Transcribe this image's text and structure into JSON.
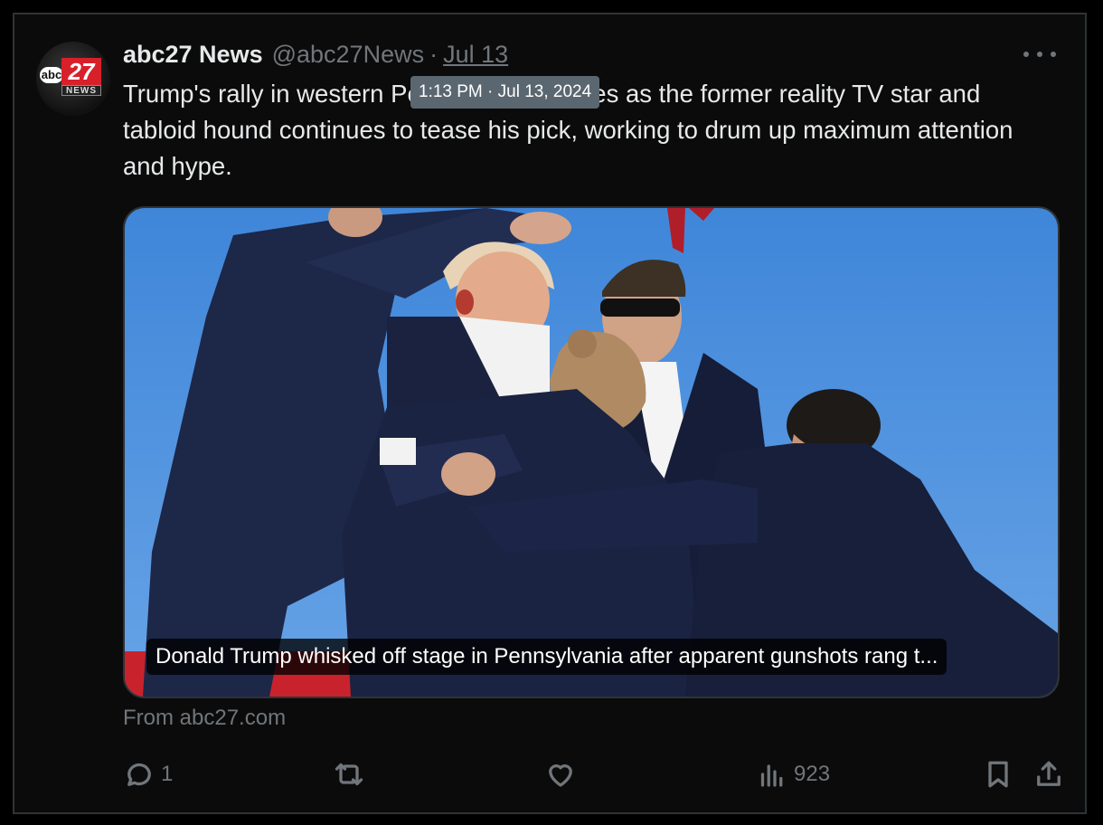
{
  "author": {
    "display_name": "abc27 News",
    "handle": "@abc27News",
    "separator": "·",
    "date": "Jul 13",
    "logo_abc": "abc",
    "logo_number": "27",
    "logo_news": "NEWS"
  },
  "tooltip": {
    "text": "1:13 PM · Jul 13, 2024"
  },
  "tweet": {
    "text": "Trump's rally in western Pennsylvania comes as the former reality TV star and tabloid hound continues to tease his pick, working to drum up maximum attention and hype."
  },
  "card": {
    "caption": "Donald Trump whisked off stage in Pennsylvania after apparent gunshots rang t...",
    "source": "From abc27.com"
  },
  "actions": {
    "reply_count": "1",
    "retweet_count": "",
    "like_count": "",
    "views_count": "923"
  },
  "colors": {
    "background": "#000000",
    "card_bg": "#0b0b0b",
    "text_primary": "#e7e9ea",
    "text_secondary": "#71767b",
    "border": "#2f3336",
    "sky": "#4d8fdc",
    "suit_navy": "#1b2440",
    "stage_red": "#c8232c"
  },
  "icons": {
    "more": "more-horizontal-icon",
    "reply": "reply-icon",
    "retweet": "retweet-icon",
    "like": "heart-icon",
    "views": "views-icon",
    "bookmark": "bookmark-icon",
    "share": "share-icon"
  }
}
